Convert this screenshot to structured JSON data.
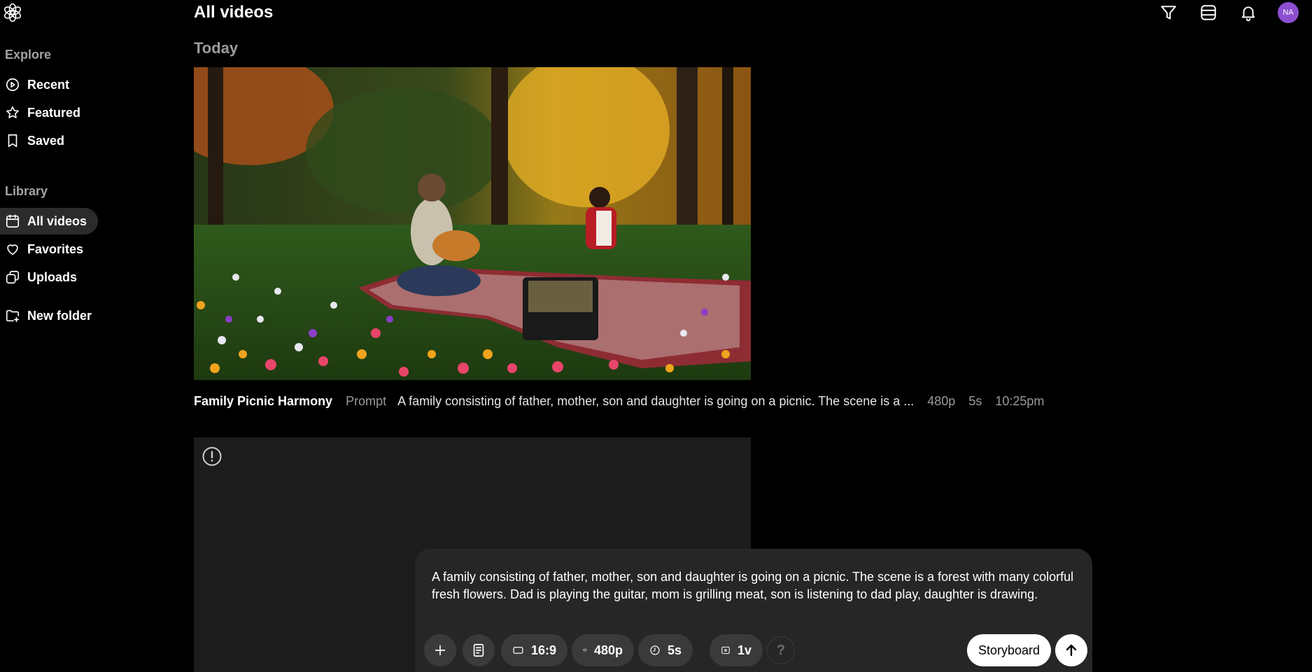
{
  "header": {
    "title": "All videos",
    "avatar_initials": "NA",
    "avatar_color": "#8c4fd1",
    "icons": [
      "filter-icon",
      "layout-icon",
      "bell-icon"
    ]
  },
  "sidebar": {
    "explore_label": "Explore",
    "library_label": "Library",
    "explore_items": [
      {
        "label": "Recent",
        "icon": "play-circle-icon"
      },
      {
        "label": "Featured",
        "icon": "star-icon"
      },
      {
        "label": "Saved",
        "icon": "bookmark-icon"
      }
    ],
    "library_items": [
      {
        "label": "All videos",
        "icon": "calendar-icon",
        "active": true
      },
      {
        "label": "Favorites",
        "icon": "heart-icon"
      },
      {
        "label": "Uploads",
        "icon": "uploads-icon"
      }
    ],
    "new_folder": {
      "label": "New folder",
      "icon": "folder-plus-icon"
    }
  },
  "main": {
    "date_heading": "Today",
    "video": {
      "title": "Family Picnic Harmony",
      "prompt_label": "Prompt",
      "prompt": "A family consisting of father, mother, son and daughter is going on a picnic. The scene is a ...",
      "resolution": "480p",
      "duration": "5s",
      "time": "10:25pm"
    }
  },
  "composer": {
    "text": "A family consisting of father, mother, son and daughter is going on a picnic. The scene is a forest with many colorful fresh flowers. Dad is playing the guitar, mom is grilling meat, son is listening to dad play, daughter is drawing.",
    "aspect_ratio": "16:9",
    "resolution": "480p",
    "duration": "5s",
    "variations": "1v",
    "help": "?",
    "storyboard_label": "Storyboard"
  }
}
